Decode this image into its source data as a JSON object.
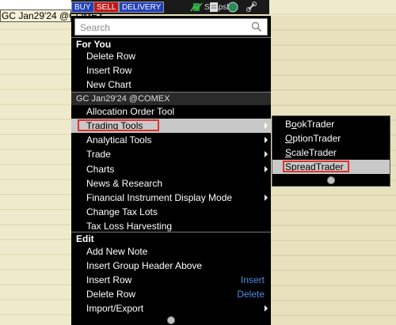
{
  "instrument": "GC Jan29'24 @COMEX",
  "toolbar": {
    "buy_label": "BUY",
    "sell_label": "SELL",
    "delivery_label": "DELIVERY",
    "snapshot_label": "Snapshot",
    "icons": [
      "chart-icon",
      "document-icon",
      "globe-icon",
      "link-icon"
    ]
  },
  "search": {
    "placeholder": "Search",
    "value": ""
  },
  "menu": {
    "section_for_you": "For You",
    "for_you_items": [
      {
        "label": "Delete Row"
      },
      {
        "label": "Insert Row"
      },
      {
        "label": "New Chart"
      }
    ],
    "instrument_section": "GC Jan29'24 @COMEX",
    "instrument_items": [
      {
        "label": "Allocation Order Tool",
        "submenu": false
      },
      {
        "label": "Trading Tools",
        "submenu": true,
        "selected": true
      },
      {
        "label": "Analytical Tools",
        "submenu": true
      },
      {
        "label": "Trade",
        "submenu": true
      },
      {
        "label": "Charts",
        "submenu": true
      },
      {
        "label": "News & Research",
        "submenu": false
      },
      {
        "label": "Financial Instrument Display Mode",
        "submenu": true
      },
      {
        "label": "Change Tax Lots",
        "submenu": false
      },
      {
        "label": "Tax Loss Harvesting",
        "submenu": false
      }
    ],
    "section_edit": "Edit",
    "edit_items": [
      {
        "label": "Add New Note",
        "shortcut": ""
      },
      {
        "label": "Insert Group Header Above",
        "shortcut": ""
      },
      {
        "label": "Insert Row",
        "shortcut": "Insert"
      },
      {
        "label": "Delete Row",
        "shortcut": "Delete"
      },
      {
        "label": "Import/Export",
        "shortcut": "",
        "submenu": true
      }
    ]
  },
  "submenu": {
    "items": [
      {
        "label": "BookTrader",
        "pre": "B",
        "u": "o",
        "post": "okTrader"
      },
      {
        "label": "OptionTrader",
        "pre": "",
        "u": "O",
        "post": "ptionTrader"
      },
      {
        "label": "ScaleTrader",
        "pre": "",
        "u": "S",
        "post": "caleTrader"
      },
      {
        "label": "SpreadTrader",
        "pre": "S",
        "u": "p",
        "post": "readTrader",
        "selected": true
      }
    ]
  },
  "colors": {
    "menu_bg": "#000000",
    "highlight_bg": "#c8c8c8",
    "callout_border": "#e03030",
    "shortcut_text": "#4a8ee8",
    "buy": "#2240b8",
    "sell": "#c01818"
  }
}
